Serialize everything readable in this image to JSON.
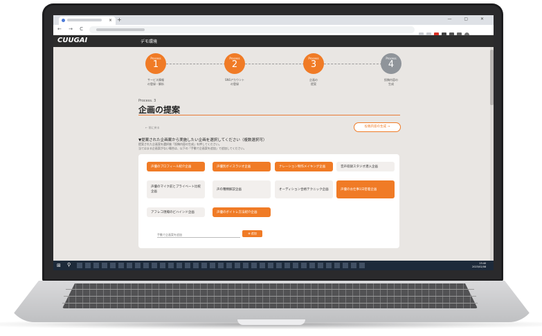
{
  "browser": {
    "new_tab": "+",
    "tab_close": "×",
    "nav_icons": "← → C ⌂",
    "window_controls": "— ▢ ✕"
  },
  "app": {
    "logo": "CUUGAI",
    "menu_label": "デモ環境"
  },
  "steps": [
    {
      "process": "Process",
      "number": "1",
      "label_line1": "サービス情報",
      "label_line2": "の登録・解析",
      "active": true
    },
    {
      "process": "Process",
      "number": "2",
      "label_line1": "SNSアカウント",
      "label_line2": "の登録",
      "active": true
    },
    {
      "process": "Process",
      "number": "3",
      "label_line1": "企画の",
      "label_line2": "提案",
      "active": true
    },
    {
      "process": "Process",
      "number": "4",
      "label_line1": "投稿内容の",
      "label_line2": "生成",
      "active": false
    }
  ],
  "section": {
    "process_label": "Process. 3",
    "title": "企画の提案",
    "back_link": "← 前に戻る",
    "generate_button": "投稿内容の生成 →",
    "instruction_title": "▼提案された企画案から実施したい企画を選択してください（複数選択可）",
    "instruction_line1": "提案された企画案を選択後「投稿内容の生成」を押してください。",
    "instruction_line2": "当てはまる企画案がない場合は、以下の「手動で企画案を追加」で追加してください。"
  },
  "options": [
    {
      "label": "声優のプロフィール紹介企画",
      "selected": true
    },
    {
      "label": "声優別ボイスラジオ企画",
      "selected": true
    },
    {
      "label": "ナレーション制作メイキング企画",
      "selected": true
    },
    {
      "label": "音声収録スタジオ潜入企画",
      "selected": false
    },
    {
      "label": "声優のマイク前とプライベート比較企画",
      "selected": false
    },
    {
      "label": "声の種類解説企画",
      "selected": false
    },
    {
      "label": "オーディション合格テクニック企画",
      "selected": false
    },
    {
      "label": "声優のお仕事1日密着企画",
      "selected": true
    },
    {
      "label": "アフレコ現場のビハインド企画",
      "selected": false
    },
    {
      "label": "声優のボイトレ方法紹介企画",
      "selected": true
    }
  ],
  "manual": {
    "placeholder": "手動で企画案を追加",
    "add_button": "⊕ 追加"
  },
  "taskbar": {
    "clock_time": "13:40",
    "clock_date": "2023/02/08"
  },
  "colors": {
    "accent": "#f07b26",
    "inactive_step": "#8f949a",
    "app_bar": "#2c2c2c"
  }
}
